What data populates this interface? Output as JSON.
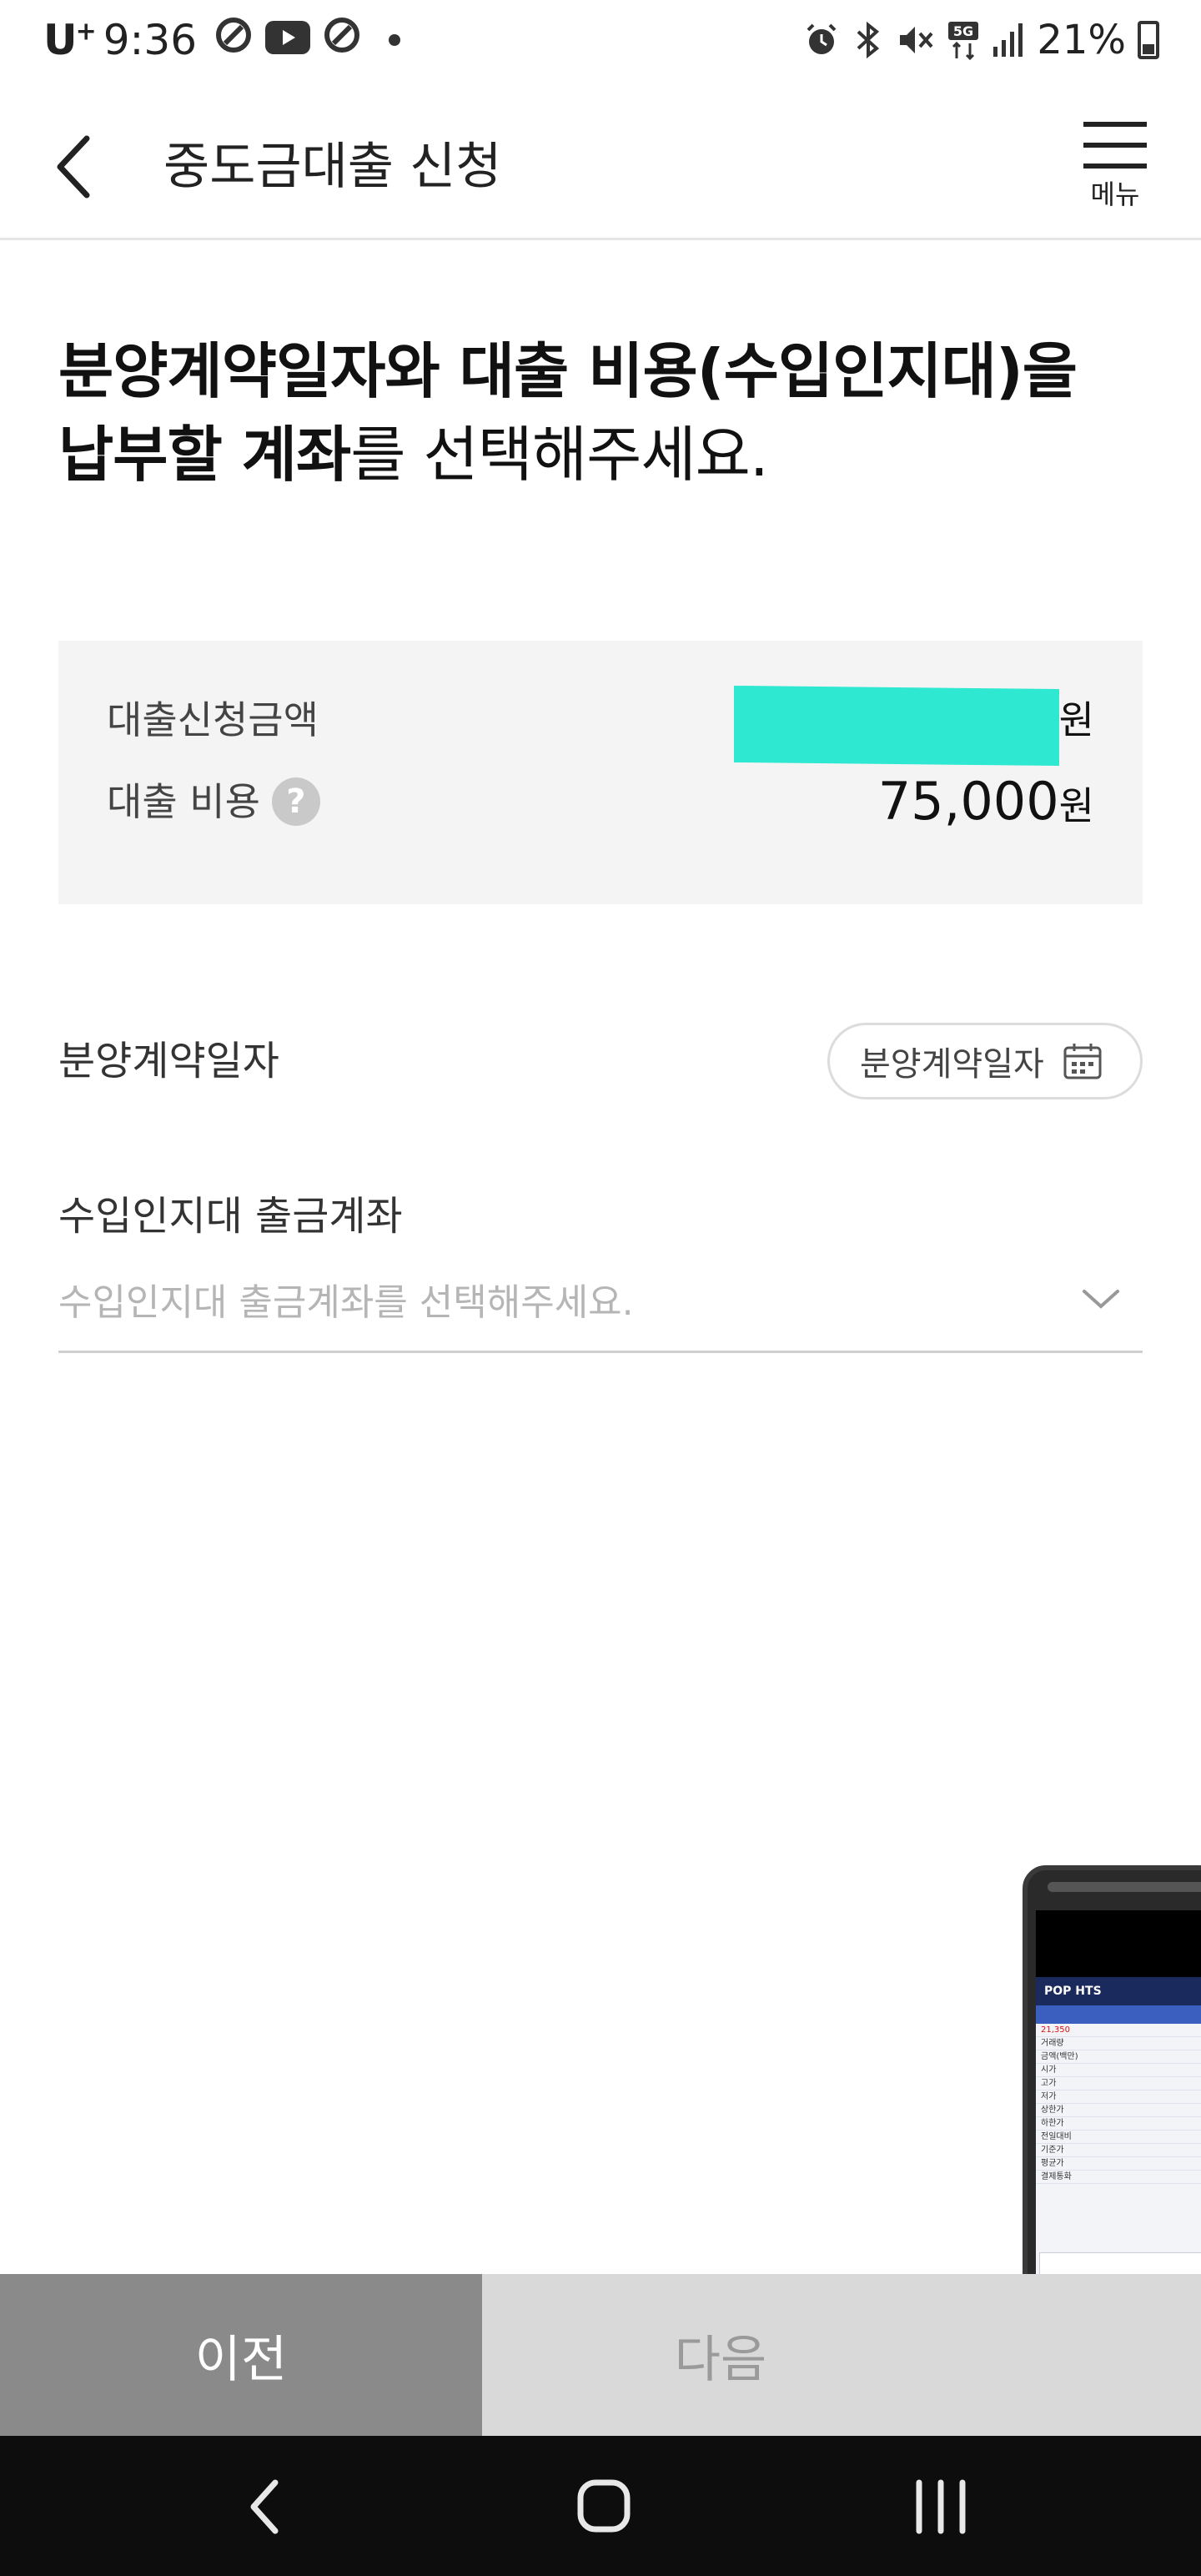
{
  "status_bar": {
    "carrier": "U",
    "carrier_sup": "+",
    "time": "9:36",
    "battery": "21%",
    "icons": [
      "notification-icon",
      "youtube-icon",
      "notification-icon",
      "alarm-icon",
      "bluetooth-icon",
      "mute-icon",
      "5g-icon",
      "signal-icon",
      "battery-icon"
    ]
  },
  "header": {
    "title": "중도금대출 신청",
    "menu_label": "메뉴"
  },
  "headline": {
    "bold_part": "분양계약일자와 대출 비용(수입인지대)을 납부할 계좌",
    "normal_part": "를 선택해주세요."
  },
  "info_card": {
    "loan_amount_label": "대출신청금액",
    "loan_amount_unit": "원",
    "loan_cost_label": "대출 비용",
    "loan_cost_help": "?",
    "loan_cost_value": "75,000",
    "loan_cost_unit": "원"
  },
  "contract_date": {
    "label": "분양계약일자",
    "button_label": "분양계약일자"
  },
  "account": {
    "label": "수입인지대 출금계좌",
    "placeholder": "수입인지대 출금계좌를 선택해주세요."
  },
  "footer": {
    "prev_label": "이전",
    "next_label": "다음"
  },
  "phone_preview": {
    "app_title": "POP HTS",
    "rows": [
      "21,350",
      "거래량",
      "금액(백만)",
      "시가",
      "고가",
      "저가",
      "상한가",
      "하한가",
      "전일대비",
      "기준가",
      "평균가",
      "결제통화"
    ]
  },
  "colors": {
    "accent_redaction": "#2ee8d2",
    "prev_button": "#8a8a8a",
    "next_button": "#d9d9d9",
    "nav_bar": "#0d0d0d"
  }
}
